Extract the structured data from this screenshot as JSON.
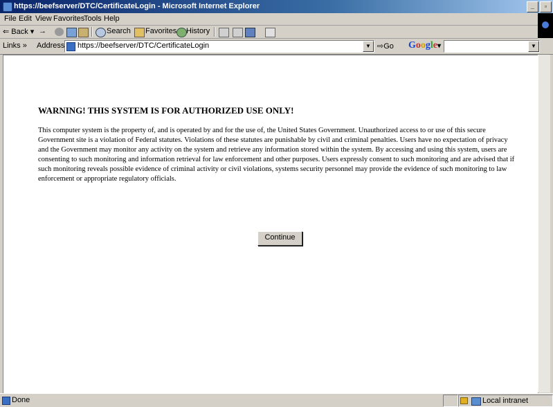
{
  "window": {
    "title": "https://beefserver/DTC/CertificateLogin - Microsoft Internet Explorer",
    "buttons": [
      "_",
      "▫"
    ]
  },
  "menu": {
    "items": [
      "File",
      "Edit",
      "View",
      "Favorites",
      "Tools",
      "Help"
    ]
  },
  "toolbar": {
    "back": "Back",
    "forward": "→",
    "search": "Search",
    "favorites": "Favorites",
    "history": "History"
  },
  "address": {
    "links": "Links »",
    "label": "Address",
    "url": "https://beefserver/DTC/CertificateLogin",
    "go": "Go",
    "google": "Google",
    "google_dropdown": "▾"
  },
  "page": {
    "heading": "WARNING! THIS SYSTEM IS FOR AUTHORIZED USE ONLY!",
    "body": "This computer system is the property of, and is operated by and for the use of, the United States Government. Unauthorized access to or use of this secure Government site is a violation of Federal statutes. Violations of these statutes are punishable by civil and criminal penalties. Users have no expectation of privacy and the Government may monitor any activity on the system and retrieve any information stored within the system. By accessing and using this system, users are consenting to such monitoring and information retrieval for law enforcement and other purposes. Users expressly consent to such monitoring and are advised that if such monitoring reveals possible evidence of criminal activity or civil violations, systems security personnel may provide the evidence of such monitoring to law enforcement or appropriate regulatory officials.",
    "continue_label": "Continue"
  },
  "status": {
    "text": "Done",
    "zone": "Local intranet"
  }
}
